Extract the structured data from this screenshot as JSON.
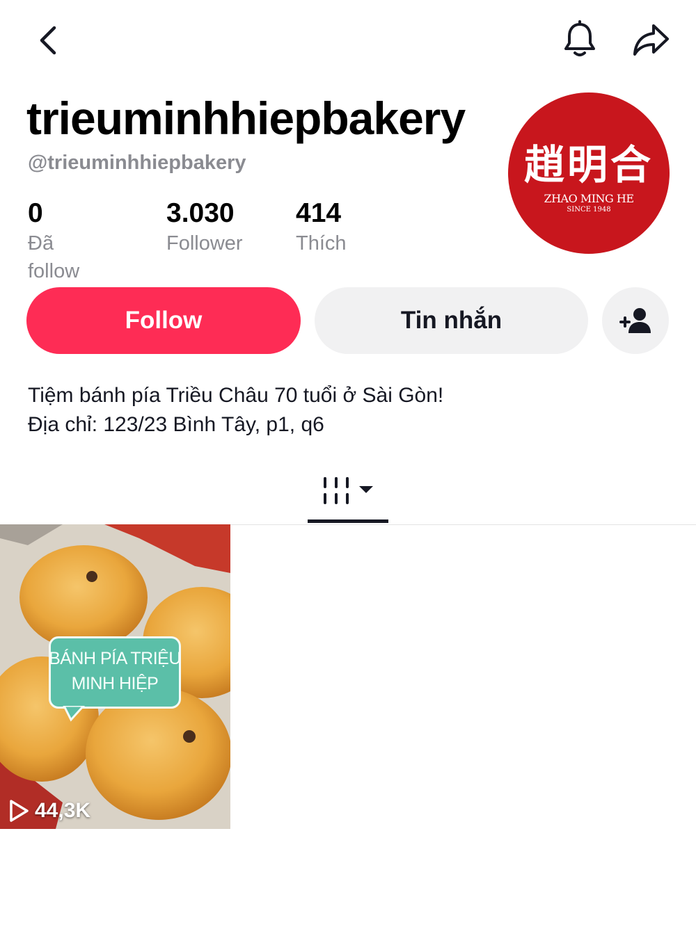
{
  "header": {
    "back_icon": "chevron-left-icon",
    "bell_icon": "bell-icon",
    "share_icon": "share-arrow-icon"
  },
  "profile": {
    "username": "trieuminhhiepbakery",
    "handle": "@trieuminhhiepbakery",
    "avatar": {
      "chinese_text": "趙明合",
      "english_text": "ZHAO MING HE",
      "since_text": "SINCE 1948",
      "bg_color": "#c8161d"
    }
  },
  "stats": [
    {
      "value": "0",
      "label": "Đã follow"
    },
    {
      "value": "3.030",
      "label": "Follower"
    },
    {
      "value": "414",
      "label": "Thích"
    }
  ],
  "actions": {
    "follow_label": "Follow",
    "message_label": "Tin nhắn",
    "add_friend_icon": "add-user-icon",
    "follow_color": "#fe2c55"
  },
  "bio": {
    "line1": "Tiệm bánh pía Triều Châu 70 tuổi ở Sài Gòn!",
    "line2": "Địa chỉ: 123/23 Bình Tây, p1, q6"
  },
  "tabs": {
    "videos_icon": "grid-icon",
    "dropdown_icon": "caret-down-icon"
  },
  "videos": [
    {
      "caption_line1": "BÁNH PÍA TRIỆU",
      "caption_line2": "MINH HIỆP",
      "views": "44,3K",
      "play_icon": "play-icon"
    }
  ]
}
